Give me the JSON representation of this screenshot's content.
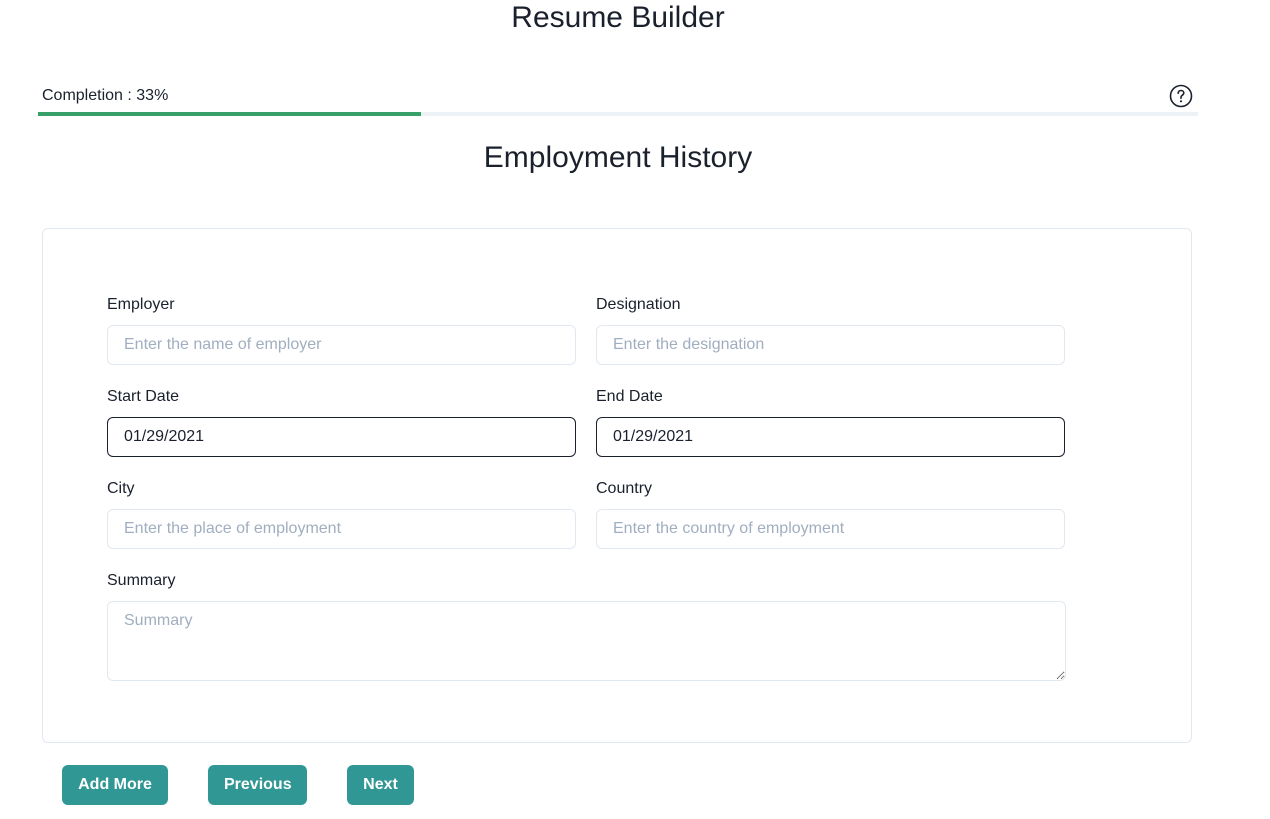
{
  "app": {
    "title": "Resume Builder"
  },
  "progress": {
    "label": "Completion : 33%",
    "percent": 33,
    "fill_color": "#38a169",
    "track_color": "#edf2f7"
  },
  "help": {
    "icon": "question-circle-icon"
  },
  "section": {
    "title": "Employment History"
  },
  "form": {
    "employer": {
      "label": "Employer",
      "placeholder": "Enter the name of employer",
      "value": ""
    },
    "designation": {
      "label": "Designation",
      "placeholder": "Enter the designation",
      "value": ""
    },
    "start_date": {
      "label": "Start Date",
      "value": "01/29/2021"
    },
    "end_date": {
      "label": "End Date",
      "value": "01/29/2021"
    },
    "city": {
      "label": "City",
      "placeholder": "Enter the place of employment",
      "value": ""
    },
    "country": {
      "label": "Country",
      "placeholder": "Enter the country of employment",
      "value": ""
    },
    "summary": {
      "label": "Summary",
      "placeholder": "Summary",
      "value": ""
    }
  },
  "buttons": {
    "add_more": "Add More",
    "previous": "Previous",
    "next": "Next",
    "color": "#319795"
  }
}
